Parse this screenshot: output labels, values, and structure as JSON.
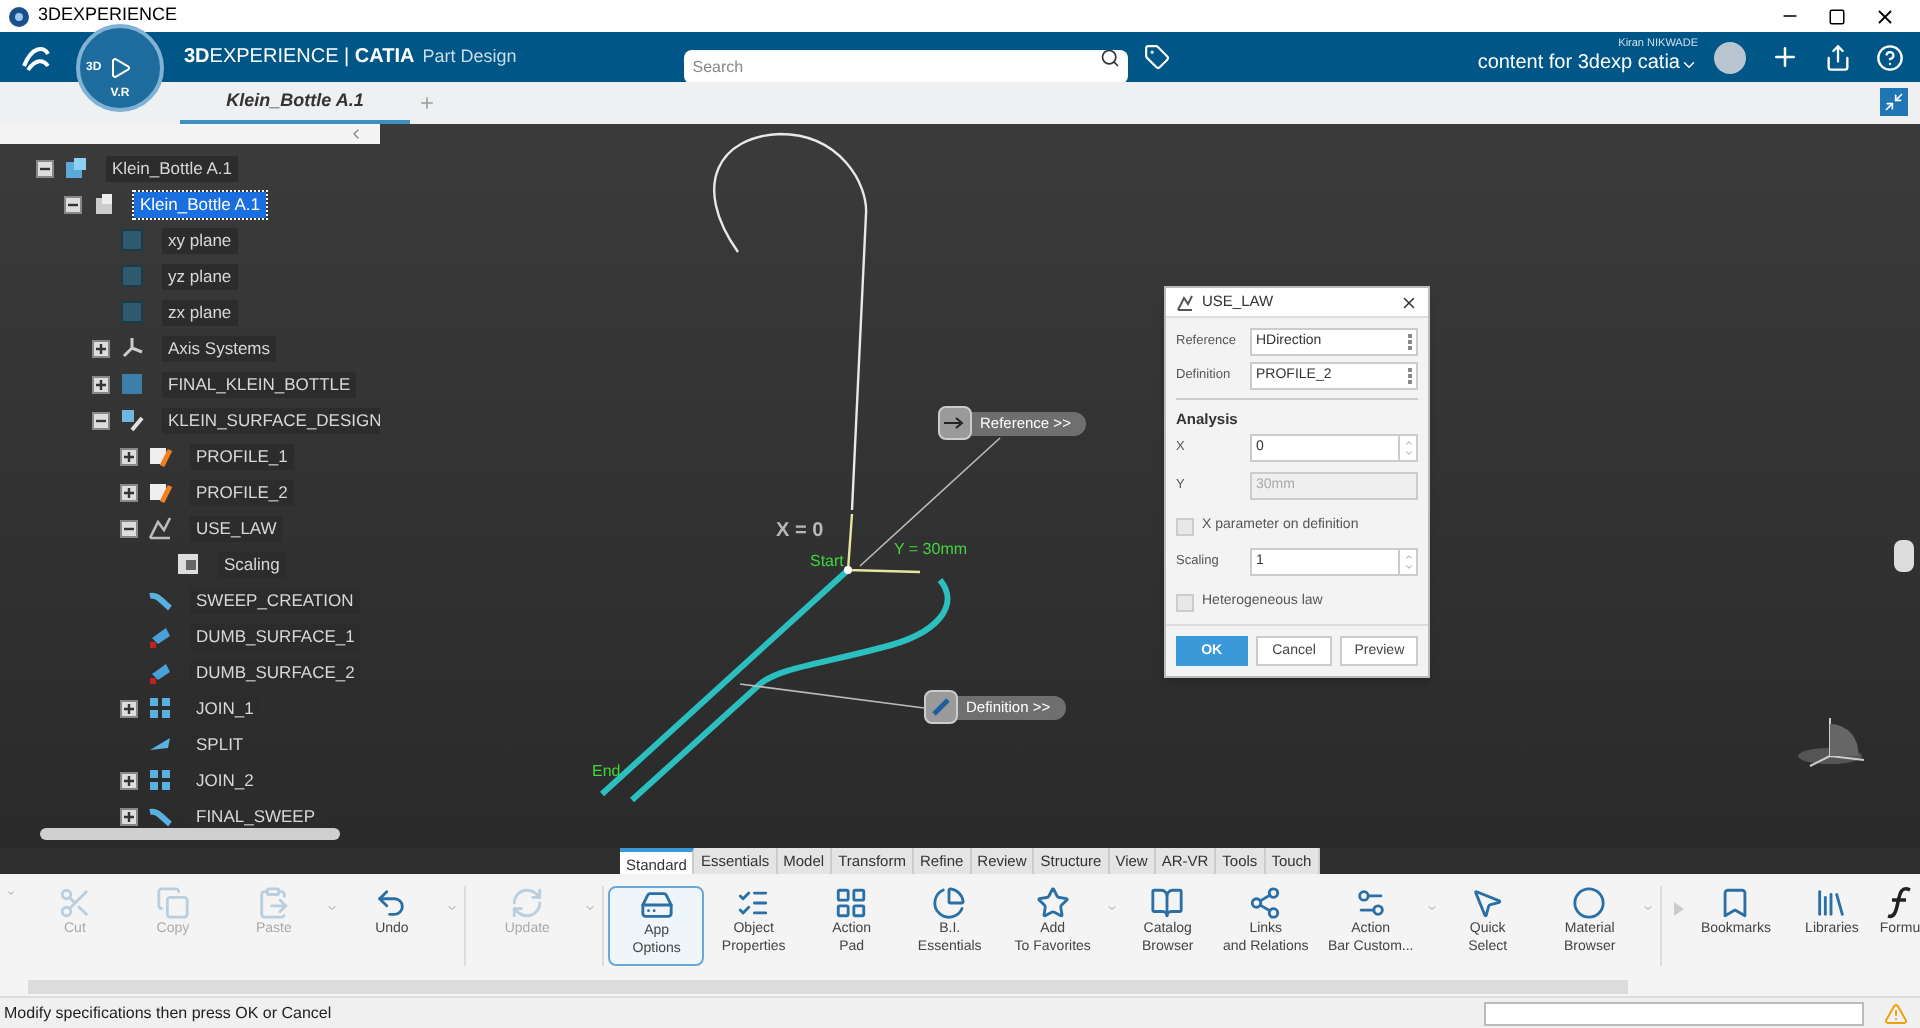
{
  "window": {
    "title": "3DEXPERIENCE"
  },
  "top_bar": {
    "compass_labels": [
      "3D",
      "V.R"
    ],
    "app_title": "**3D**EXPERIENCE | **CATIA**",
    "app_subtitle": "Part Design",
    "search": {
      "placeholder": "Search"
    },
    "user_name": "Kiran NIKWADE",
    "collab_space": "content for 3dexp catia"
  },
  "document_tabs": [
    {
      "label": "Klein_Bottle A.1",
      "selected": true
    }
  ],
  "tree": [
    {
      "label": "Klein_Bottle A.1",
      "kind": "product",
      "selected": false,
      "expanded": true,
      "children": [
        {
          "label": "Klein_Bottle A.1",
          "kind": "part",
          "selected": true,
          "expanded": true,
          "children": [
            {
              "label": "xy plane",
              "kind": "plane",
              "selected": false
            },
            {
              "label": "yz plane",
              "kind": "plane",
              "selected": false
            },
            {
              "label": "zx plane",
              "kind": "plane",
              "selected": false
            },
            {
              "label": "Axis Systems",
              "kind": "axis",
              "selected": false,
              "expanded": false
            },
            {
              "label": "FINAL_KLEIN_BOTTLE",
              "kind": "body",
              "selected": false,
              "expanded": false
            },
            {
              "label": "KLEIN_SURFACE_DESIGN",
              "kind": "geoset",
              "selected": false,
              "expanded": true,
              "children": [
                {
                  "label": "PROFILE_1",
                  "kind": "sketch",
                  "selected": false,
                  "expanded": false
                },
                {
                  "label": "PROFILE_2",
                  "kind": "sketch",
                  "selected": false,
                  "expanded": false
                },
                {
                  "label": "USE_LAW",
                  "kind": "law",
                  "selected": false,
                  "expanded": true,
                  "children": [
                    {
                      "label": "Scaling",
                      "kind": "parameter",
                      "selected": false
                    }
                  ]
                },
                {
                  "label": "SWEEP_CREATION",
                  "kind": "sweep",
                  "selected": false
                },
                {
                  "label": "DUMB_SURFACE_1",
                  "kind": "surface",
                  "selected": false
                },
                {
                  "label": "DUMB_SURFACE_2",
                  "kind": "surface",
                  "selected": false
                },
                {
                  "label": "JOIN_1",
                  "kind": "join",
                  "selected": false,
                  "expanded": false
                },
                {
                  "label": "SPLIT",
                  "kind": "split",
                  "selected": false
                },
                {
                  "label": "JOIN_2",
                  "kind": "join",
                  "selected": false,
                  "expanded": false
                },
                {
                  "label": "FINAL_SWEEP",
                  "kind": "sweep",
                  "selected": false,
                  "expanded": false
                }
              ]
            }
          ]
        }
      ]
    }
  ],
  "viewport": {
    "labels": [
      {
        "text": "X = 0",
        "kind": "axis"
      },
      {
        "text": "Start",
        "kind": "marker"
      },
      {
        "text": "Y = 30mm",
        "kind": "marker"
      },
      {
        "text": "End",
        "kind": "marker"
      }
    ],
    "callouts": [
      {
        "text": "Reference >>",
        "kind": "arrow"
      },
      {
        "text": "Definition >>",
        "kind": "pencil"
      }
    ]
  },
  "dialog": {
    "title": "USE_LAW",
    "fields": [
      {
        "label": "Reference",
        "value": "HDirection"
      },
      {
        "label": "Definition",
        "value": "PROFILE_2"
      }
    ],
    "section": "Analysis",
    "rows": [
      {
        "kind": "spinner",
        "label": "X",
        "value": "0",
        "disabled": false
      },
      {
        "kind": "text",
        "label": "Y",
        "value": "30mm",
        "disabled": true
      },
      {
        "kind": "checkbox",
        "label": "X parameter on definition",
        "checked": false
      },
      {
        "kind": "spinner",
        "label": "Scaling",
        "value": "1",
        "disabled": false
      },
      {
        "kind": "checkbox",
        "label": "Heterogeneous law",
        "checked": false
      }
    ],
    "buttons": [
      {
        "label": "OK",
        "primary": true
      },
      {
        "label": "Cancel",
        "primary": false
      },
      {
        "label": "Preview",
        "primary": false
      }
    ]
  },
  "action_bar": {
    "tabs": [
      {
        "label": "Standard",
        "selected": true
      },
      {
        "label": "Essentials",
        "selected": false
      },
      {
        "label": "Model",
        "selected": false
      },
      {
        "label": "Transform",
        "selected": false
      },
      {
        "label": "Refine",
        "selected": false
      },
      {
        "label": "Review",
        "selected": false
      },
      {
        "label": "Structure",
        "selected": false
      },
      {
        "label": "View",
        "selected": false
      },
      {
        "label": "AR-VR",
        "selected": false
      },
      {
        "label": "Tools",
        "selected": false
      },
      {
        "label": "Touch",
        "selected": false
      }
    ],
    "commands": [
      {
        "label": "Cut",
        "disabled": true,
        "dropdown": false,
        "selected": false
      },
      {
        "label": "Copy",
        "disabled": true,
        "dropdown": false,
        "selected": false
      },
      {
        "label": "Paste",
        "disabled": true,
        "dropdown": true,
        "selected": false
      },
      {
        "label": "Undo",
        "disabled": false,
        "dropdown": true,
        "selected": false
      },
      {
        "label": "Update",
        "disabled": true,
        "dropdown": true,
        "selected": false
      },
      {
        "label": "App\nOptions",
        "disabled": false,
        "dropdown": false,
        "selected": true
      },
      {
        "label": "Object\nProperties",
        "disabled": false,
        "dropdown": false,
        "selected": false
      },
      {
        "label": "Action\nPad",
        "disabled": false,
        "dropdown": false,
        "selected": false
      },
      {
        "label": "B.I.\nEssentials",
        "disabled": false,
        "dropdown": false,
        "selected": false
      },
      {
        "label": "Add\nTo Favorites",
        "disabled": false,
        "dropdown": true,
        "selected": false
      },
      {
        "label": "Catalog\nBrowser",
        "disabled": false,
        "dropdown": false,
        "selected": false
      },
      {
        "label": "Links\nand Relations",
        "disabled": false,
        "dropdown": false,
        "selected": false
      },
      {
        "label": "Action\nBar Custom...",
        "disabled": false,
        "dropdown": true,
        "selected": false
      },
      {
        "label": "Quick\nSelect",
        "disabled": false,
        "dropdown": false,
        "selected": false
      },
      {
        "label": "Material\nBrowser",
        "disabled": false,
        "dropdown": true,
        "selected": false
      },
      {
        "label": "Bookmarks",
        "disabled": false,
        "dropdown": false,
        "selected": false
      },
      {
        "label": "Libraries",
        "disabled": false,
        "dropdown": false,
        "selected": false
      },
      {
        "label": "Formu",
        "disabled": false,
        "dropdown": false,
        "selected": false
      }
    ]
  },
  "status_bar": {
    "message": "Modify specifications then press OK or Cancel"
  }
}
